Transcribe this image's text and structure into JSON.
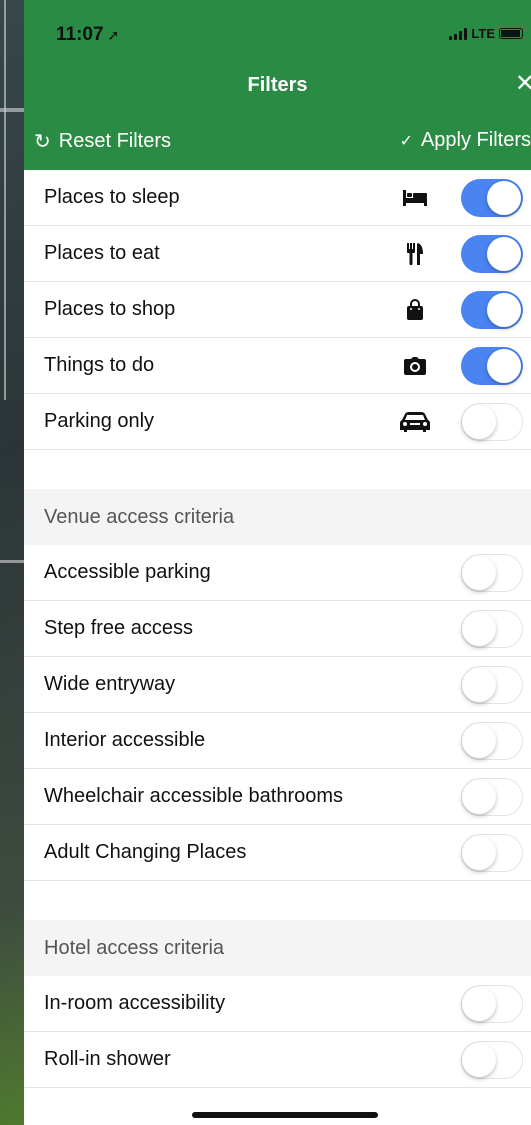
{
  "status": {
    "time": "11:07",
    "network": "LTE"
  },
  "header": {
    "title": "Filters",
    "close_icon": "close-icon",
    "reset_label": "Reset Filters",
    "apply_label": "Apply Filters"
  },
  "categories": [
    {
      "label": "Places to sleep",
      "icon": "bed-icon",
      "on": true
    },
    {
      "label": "Places to eat",
      "icon": "fork-knife-icon",
      "on": true
    },
    {
      "label": "Places to shop",
      "icon": "shopping-bag-icon",
      "on": true
    },
    {
      "label": "Things to do",
      "icon": "camera-icon",
      "on": true
    },
    {
      "label": "Parking only",
      "icon": "car-icon",
      "on": false
    }
  ],
  "venue_section": {
    "title": "Venue access criteria",
    "items": [
      {
        "label": "Accessible parking",
        "on": false
      },
      {
        "label": "Step free access",
        "on": false
      },
      {
        "label": "Wide entryway",
        "on": false
      },
      {
        "label": "Interior accessible",
        "on": false
      },
      {
        "label": "Wheelchair accessible bathrooms",
        "on": false
      },
      {
        "label": "Adult Changing Places",
        "on": false
      }
    ]
  },
  "hotel_section": {
    "title": "Hotel access criteria",
    "items": [
      {
        "label": "In-room accessibility",
        "on": false
      },
      {
        "label": "Roll-in shower",
        "on": false
      }
    ]
  },
  "colors": {
    "header_green": "#2a8c44",
    "toggle_on": "#4a84f0"
  }
}
